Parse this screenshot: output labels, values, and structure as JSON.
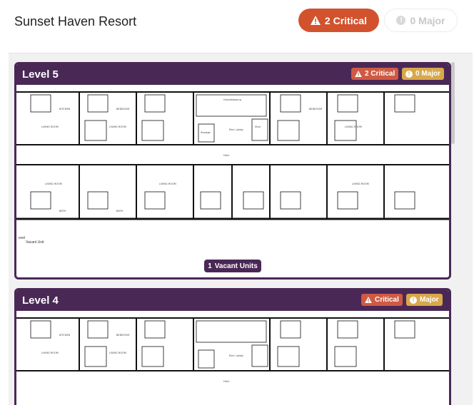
{
  "header": {
    "title": "Sunset Haven Resort",
    "critical_label": "2 Critical",
    "major_label": "0 Major"
  },
  "levels": [
    {
      "name": "Level 5",
      "critical_label": "2 Critical",
      "major_label": "0 Major",
      "vacant_count": "1",
      "vacant_label": "Vacant Units",
      "legend_title": "evel",
      "legend_item": "Vacant Unit"
    },
    {
      "name": "Level 4",
      "critical_label": "Critical",
      "major_label": "Major"
    }
  ],
  "plan_labels": {
    "living": "LIVING ROOM",
    "bed": "BEDROOM",
    "bath": "BATH",
    "kitchen": "KITCHEN",
    "housekeeping": "Housekeeping",
    "storage": "Storage",
    "lobby": "Elev. Lobby",
    "stair": "Stair",
    "hall": "HALL"
  },
  "colors": {
    "critical": "#d2522e",
    "major": "#d9a84a",
    "level_header": "#4a2856"
  },
  "icons": [
    "warning-triangle-icon",
    "info-circle-icon"
  ]
}
